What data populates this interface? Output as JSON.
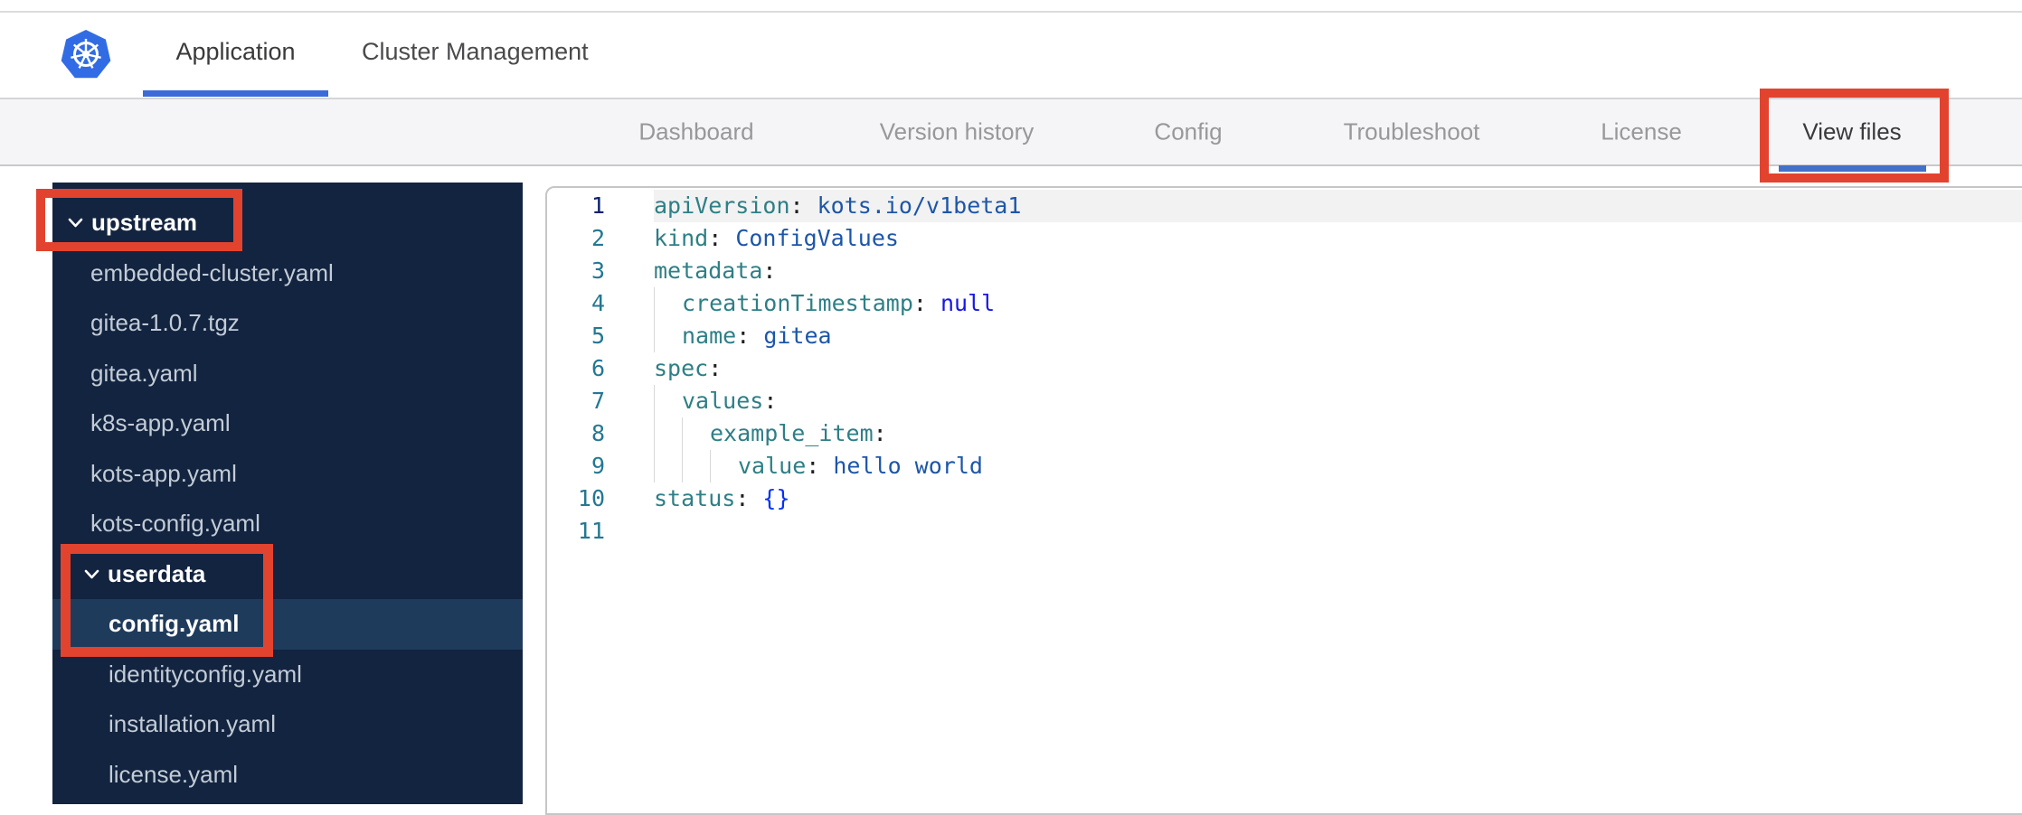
{
  "header": {
    "brand_icon": "kubernetes-logo",
    "tabs": [
      {
        "label": "Application",
        "active": true
      },
      {
        "label": "Cluster Management",
        "active": false
      }
    ]
  },
  "nav": {
    "tabs": [
      {
        "label": "Dashboard",
        "active": false,
        "annotated": false
      },
      {
        "label": "Version history",
        "active": false,
        "annotated": false
      },
      {
        "label": "Config",
        "active": false,
        "annotated": false
      },
      {
        "label": "Troubleshoot",
        "active": false,
        "annotated": false
      },
      {
        "label": "License",
        "active": false,
        "annotated": false
      },
      {
        "label": "View files",
        "active": true,
        "annotated": true
      }
    ]
  },
  "sidebar": {
    "items": [
      {
        "kind": "folder",
        "label": "upstream",
        "depth": 0,
        "expanded": true,
        "selected": false,
        "annotated": true
      },
      {
        "kind": "file",
        "label": "embedded-cluster.yaml",
        "depth": 1,
        "selected": false,
        "annotated": false
      },
      {
        "kind": "file",
        "label": "gitea-1.0.7.tgz",
        "depth": 1,
        "selected": false,
        "annotated": false
      },
      {
        "kind": "file",
        "label": "gitea.yaml",
        "depth": 1,
        "selected": false,
        "annotated": false
      },
      {
        "kind": "file",
        "label": "k8s-app.yaml",
        "depth": 1,
        "selected": false,
        "annotated": false
      },
      {
        "kind": "file",
        "label": "kots-app.yaml",
        "depth": 1,
        "selected": false,
        "annotated": false
      },
      {
        "kind": "file",
        "label": "kots-config.yaml",
        "depth": 1,
        "selected": false,
        "annotated": false
      },
      {
        "kind": "folder",
        "label": "userdata",
        "depth": 1,
        "expanded": true,
        "selected": false,
        "annotated": true
      },
      {
        "kind": "file",
        "label": "config.yaml",
        "depth": 2,
        "selected": true,
        "annotated": true
      },
      {
        "kind": "file",
        "label": "identityconfig.yaml",
        "depth": 2,
        "selected": false,
        "annotated": false
      },
      {
        "kind": "file",
        "label": "installation.yaml",
        "depth": 2,
        "selected": false,
        "annotated": false
      },
      {
        "kind": "file",
        "label": "license.yaml",
        "depth": 2,
        "selected": false,
        "annotated": false
      }
    ]
  },
  "editor": {
    "language": "yaml",
    "active_line": 1,
    "lines": [
      {
        "n": 1,
        "indent": 0,
        "tokens": [
          {
            "type": "key",
            "text": "apiVersion"
          },
          {
            "type": "punct",
            "text": ": "
          },
          {
            "type": "str",
            "text": "kots.io/v1beta1"
          }
        ]
      },
      {
        "n": 2,
        "indent": 0,
        "tokens": [
          {
            "type": "key",
            "text": "kind"
          },
          {
            "type": "punct",
            "text": ": "
          },
          {
            "type": "str",
            "text": "ConfigValues"
          }
        ]
      },
      {
        "n": 3,
        "indent": 0,
        "tokens": [
          {
            "type": "key",
            "text": "metadata"
          },
          {
            "type": "punct",
            "text": ":"
          }
        ]
      },
      {
        "n": 4,
        "indent": 1,
        "tokens": [
          {
            "type": "key",
            "text": "creationTimestamp"
          },
          {
            "type": "punct",
            "text": ": "
          },
          {
            "type": "keyword",
            "text": "null"
          }
        ]
      },
      {
        "n": 5,
        "indent": 1,
        "tokens": [
          {
            "type": "key",
            "text": "name"
          },
          {
            "type": "punct",
            "text": ": "
          },
          {
            "type": "str",
            "text": "gitea"
          }
        ]
      },
      {
        "n": 6,
        "indent": 0,
        "tokens": [
          {
            "type": "key",
            "text": "spec"
          },
          {
            "type": "punct",
            "text": ":"
          }
        ]
      },
      {
        "n": 7,
        "indent": 1,
        "tokens": [
          {
            "type": "key",
            "text": "values"
          },
          {
            "type": "punct",
            "text": ":"
          }
        ]
      },
      {
        "n": 8,
        "indent": 2,
        "tokens": [
          {
            "type": "key",
            "text": "example_item"
          },
          {
            "type": "punct",
            "text": ":"
          }
        ]
      },
      {
        "n": 9,
        "indent": 3,
        "tokens": [
          {
            "type": "key",
            "text": "value"
          },
          {
            "type": "punct",
            "text": ": "
          },
          {
            "type": "str",
            "text": "hello world"
          }
        ]
      },
      {
        "n": 10,
        "indent": 0,
        "tokens": [
          {
            "type": "key",
            "text": "status"
          },
          {
            "type": "punct",
            "text": ": "
          },
          {
            "type": "bracket",
            "text": "{}"
          }
        ]
      },
      {
        "n": 11,
        "indent": 0,
        "tokens": []
      }
    ]
  },
  "colors": {
    "annotation_red": "#E2432F",
    "kubernetes_blue": "#326CE5",
    "active_tab_underline": "#3A6BD8",
    "nav_active_underline": "#4470C8",
    "sidebar_bg": "#132440",
    "sidebar_selected_bg": "#1F3B5C",
    "code_key": "#2E7F86",
    "code_string": "#1D56A8",
    "code_keyword": "#1717E6",
    "code_bracket": "#0431FA",
    "line_number": "#237893",
    "line_number_active": "#0B216F"
  }
}
